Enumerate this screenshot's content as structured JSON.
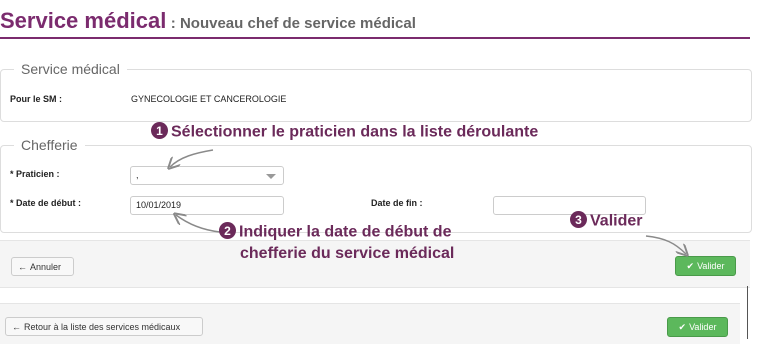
{
  "header": {
    "title": "Service médical",
    "subtitle": ": Nouveau chef de service médical"
  },
  "service_section": {
    "legend": "Service médical",
    "sm_label": "Pour le SM :",
    "sm_value": "GYNECOLOGIE ET CANCEROLOGIE"
  },
  "chefferie_section": {
    "legend": "Chefferie",
    "praticien_label": "* Praticien :",
    "praticien_value": ",",
    "date_debut_label": "* Date de début :",
    "date_debut_value": "10/01/2019",
    "date_fin_label": "Date de fin :",
    "date_fin_value": ""
  },
  "form_actions": {
    "cancel_label": "Annuler",
    "validate_label": "Valider"
  },
  "footer_actions": {
    "back_label": "Retour à la liste des services médicaux",
    "validate_label": "Valider"
  },
  "annotations": {
    "step1_number": "1",
    "step1_text": "Sélectionner le praticien dans la liste déroulante",
    "step2_number": "2",
    "step2_line1": "Indiquer la date de début de",
    "step2_line2": "chefferie du service médical",
    "step3_number": "3",
    "step3_text": "Valider"
  },
  "colors": {
    "brand": "#7b2b6e",
    "annotation": "#6b2a5a",
    "success": "#5cb85c"
  }
}
